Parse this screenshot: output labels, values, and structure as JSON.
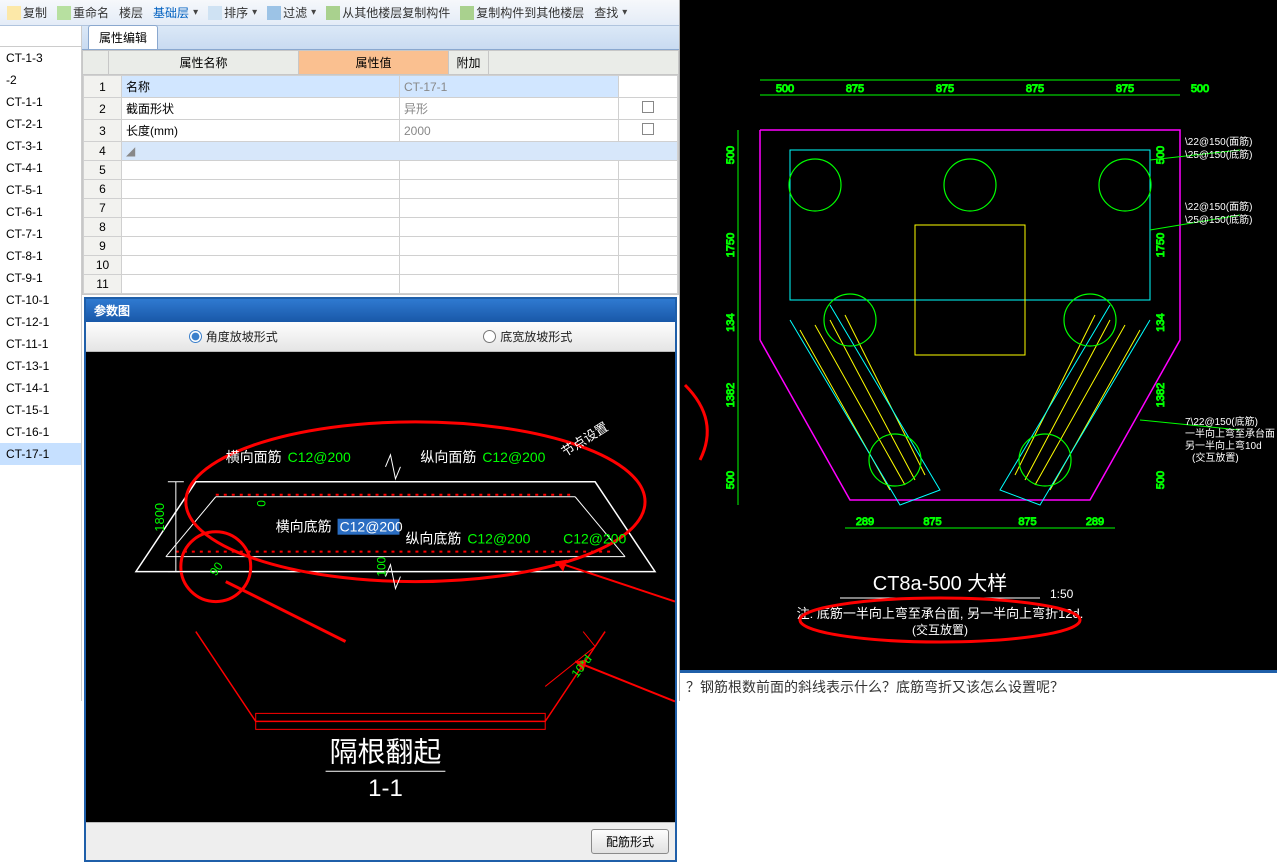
{
  "toolbar": {
    "copy": "复制",
    "rename": "重命名",
    "floor_lbl": "楼层",
    "floor_val": "基础层",
    "sort": "排序",
    "filter": "过滤",
    "copy_from": "从其他楼层复制构件",
    "copy_to": "复制构件到其他楼层",
    "find": "查找"
  },
  "side_items": [
    "CT-1-3",
    "-2",
    "CT-1-1",
    "CT-2-1",
    "CT-3-1",
    "CT-4-1",
    "CT-5-1",
    "CT-6-1",
    "CT-7-1",
    "CT-8-1",
    "CT-9-1",
    "CT-10-1",
    "CT-12-1",
    "CT-11-1",
    "CT-13-1",
    "CT-14-1",
    "CT-15-1",
    "CT-16-1",
    "CT-17-1"
  ],
  "side_selected": 18,
  "tab": "属性编辑",
  "prop_headers": {
    "name": "属性名称",
    "val": "属性值",
    "add": "附加"
  },
  "props": [
    {
      "n": "1",
      "name": "名称",
      "val": "CT-17-1",
      "add": false,
      "sel": true
    },
    {
      "n": "2",
      "name": "截面形状",
      "val": "异形",
      "add": true
    },
    {
      "n": "3",
      "name": "长度(mm)",
      "val": "2000",
      "add": true
    }
  ],
  "empty_rows": [
    "4",
    "5",
    "6",
    "7",
    "8",
    "9",
    "10",
    "11"
  ],
  "dialog": {
    "title": "参数图",
    "radio1": "角度放坡形式",
    "radio2": "底宽放坡形式",
    "btn": "配筋形式"
  },
  "diagram_labels": {
    "h1800": "1800",
    "h0": "0",
    "a90": "90",
    "h100": "100",
    "hx_t": "横向面筋",
    "hx_t_v": "C12@200",
    "zx_t": "纵向面筋",
    "zx_t_v": "C12@200",
    "hx_b": "横向底筋",
    "hx_b_v": "C12@200",
    "zx_b": "纵向底筋",
    "zx_b_v": "C12@200",
    "side_v": "C12@200",
    "node": "节点设置",
    "d10": "10*d",
    "title": "隔根翻起",
    "sub": "1-1"
  },
  "cad": {
    "dims_top": [
      "500",
      "875",
      "875",
      "875",
      "875",
      "500"
    ],
    "dims_bot": [
      "289",
      "875",
      "875",
      "289"
    ],
    "dims_left": [
      "500",
      "1750",
      "134",
      "1382",
      "500"
    ],
    "dims_right": [
      "500",
      "1750",
      "134",
      "1382",
      "500"
    ],
    "notes_r1a": "\\22@150(面筋)",
    "notes_r1b": "\\25@150(底筋)",
    "notes_r2a": "\\22@150(面筋)",
    "notes_r2b": "\\25@150(底筋)",
    "notes_r3a": "7\\22@150(底筋)",
    "notes_r3b": "一半向上弯至承台面",
    "notes_r3c": "另一半向上弯10d",
    "notes_r3d": "(交互放置)",
    "title": "CT8a-500 大样",
    "scale": "1:50",
    "note_main": "注: 底筋一半向上弯至承台面, 另一半向上弯折12d.",
    "note_sub": "(交互放置)"
  },
  "question": "？钢筋根数前面的斜线表示什么？底筋弯折又该怎么设置呢？"
}
